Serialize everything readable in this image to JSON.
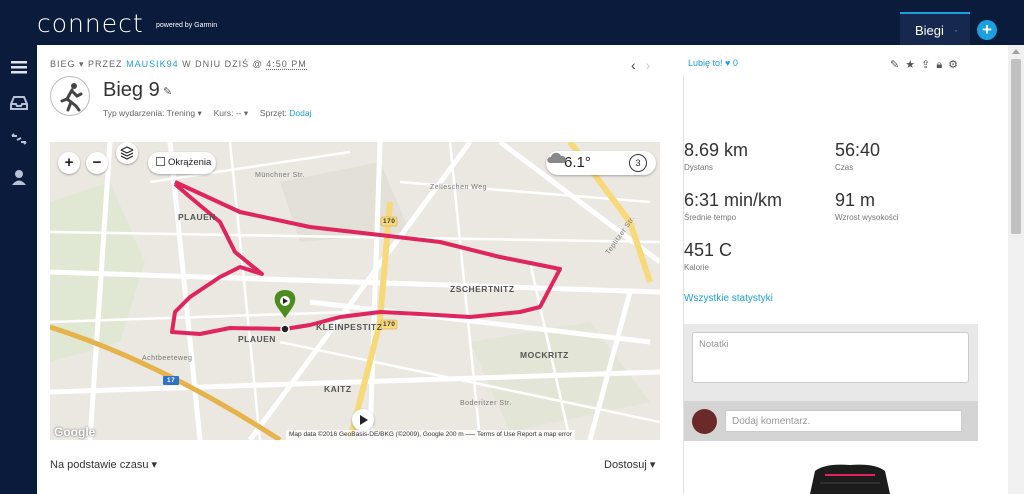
{
  "header": {
    "logo": "connect",
    "logo_sub": "powered by Garmin",
    "tab_label": "Biegi",
    "tab_sep": "·",
    "plus_label": "+"
  },
  "activity": {
    "breadcrumb_type": "BIEG",
    "breadcrumb_by": "▾  PRZEZ",
    "user": "MAUSIK94",
    "breadcrumb_when": "W DNIU DZIŚ @",
    "time": "4:50 PM",
    "title": "Bieg 9",
    "event_type_label": "Typ wydarzenia:",
    "event_type_value": "Trening ▾",
    "course_label": "Kurs:",
    "course_value": "-- ▾",
    "gear_label": "Sprzęt:",
    "gear_link": "Dodaj"
  },
  "map": {
    "checkbox_label": "Okrążenia",
    "temperature": "6.1°",
    "weather_count": "3",
    "labels": {
      "plauen_top": "PLAUEN",
      "plauen_bottom": "PLAUEN",
      "kleinpestitz": "KLEINPESTITZ",
      "zschertnitz": "ZSCHERTNITZ",
      "mockritz": "MOCKRITZ",
      "kaitz": "KAITZ",
      "road_170": "170",
      "road_170b": "170",
      "road_17": "17",
      "street_1": "Münchner Str.",
      "street_2": "Zelleschen Weg",
      "street_3": "Teplitzer Str.",
      "street_4": "Achtbeeteweg",
      "street_5": "Boderitzer Str."
    },
    "google": "Google",
    "footer": "Map data ©2016 GeoBasis-DE/BKG (©2009), Google    200 m ⎯⎯⎯    Terms of Use    Report a map error"
  },
  "like": {
    "label": "Lubię to!",
    "count": "0"
  },
  "stats": {
    "distance_value": "8.69 km",
    "distance_label": "Dystans",
    "time_value": "56:40",
    "time_label": "Czas",
    "pace_value": "6:31 min/km",
    "pace_label": "Średnie tempo",
    "elev_value": "91 m",
    "elev_label": "Wzrost wysokości",
    "cal_value": "451 C",
    "cal_label": "Kalorie",
    "all_stats_link": "Wszystkie statystyki"
  },
  "notes": {
    "placeholder": "Notatki",
    "comment_placeholder": "Dodaj komentarz."
  },
  "footer": {
    "sort_label": "Na podstawie czasu ▾",
    "customize_label": "Dostosuj ▾"
  },
  "colors": {
    "nav_bg": "#0b1b3c",
    "accent": "#1aa0e0",
    "route": "#e0245e",
    "start_marker": "#4d8c1f"
  }
}
